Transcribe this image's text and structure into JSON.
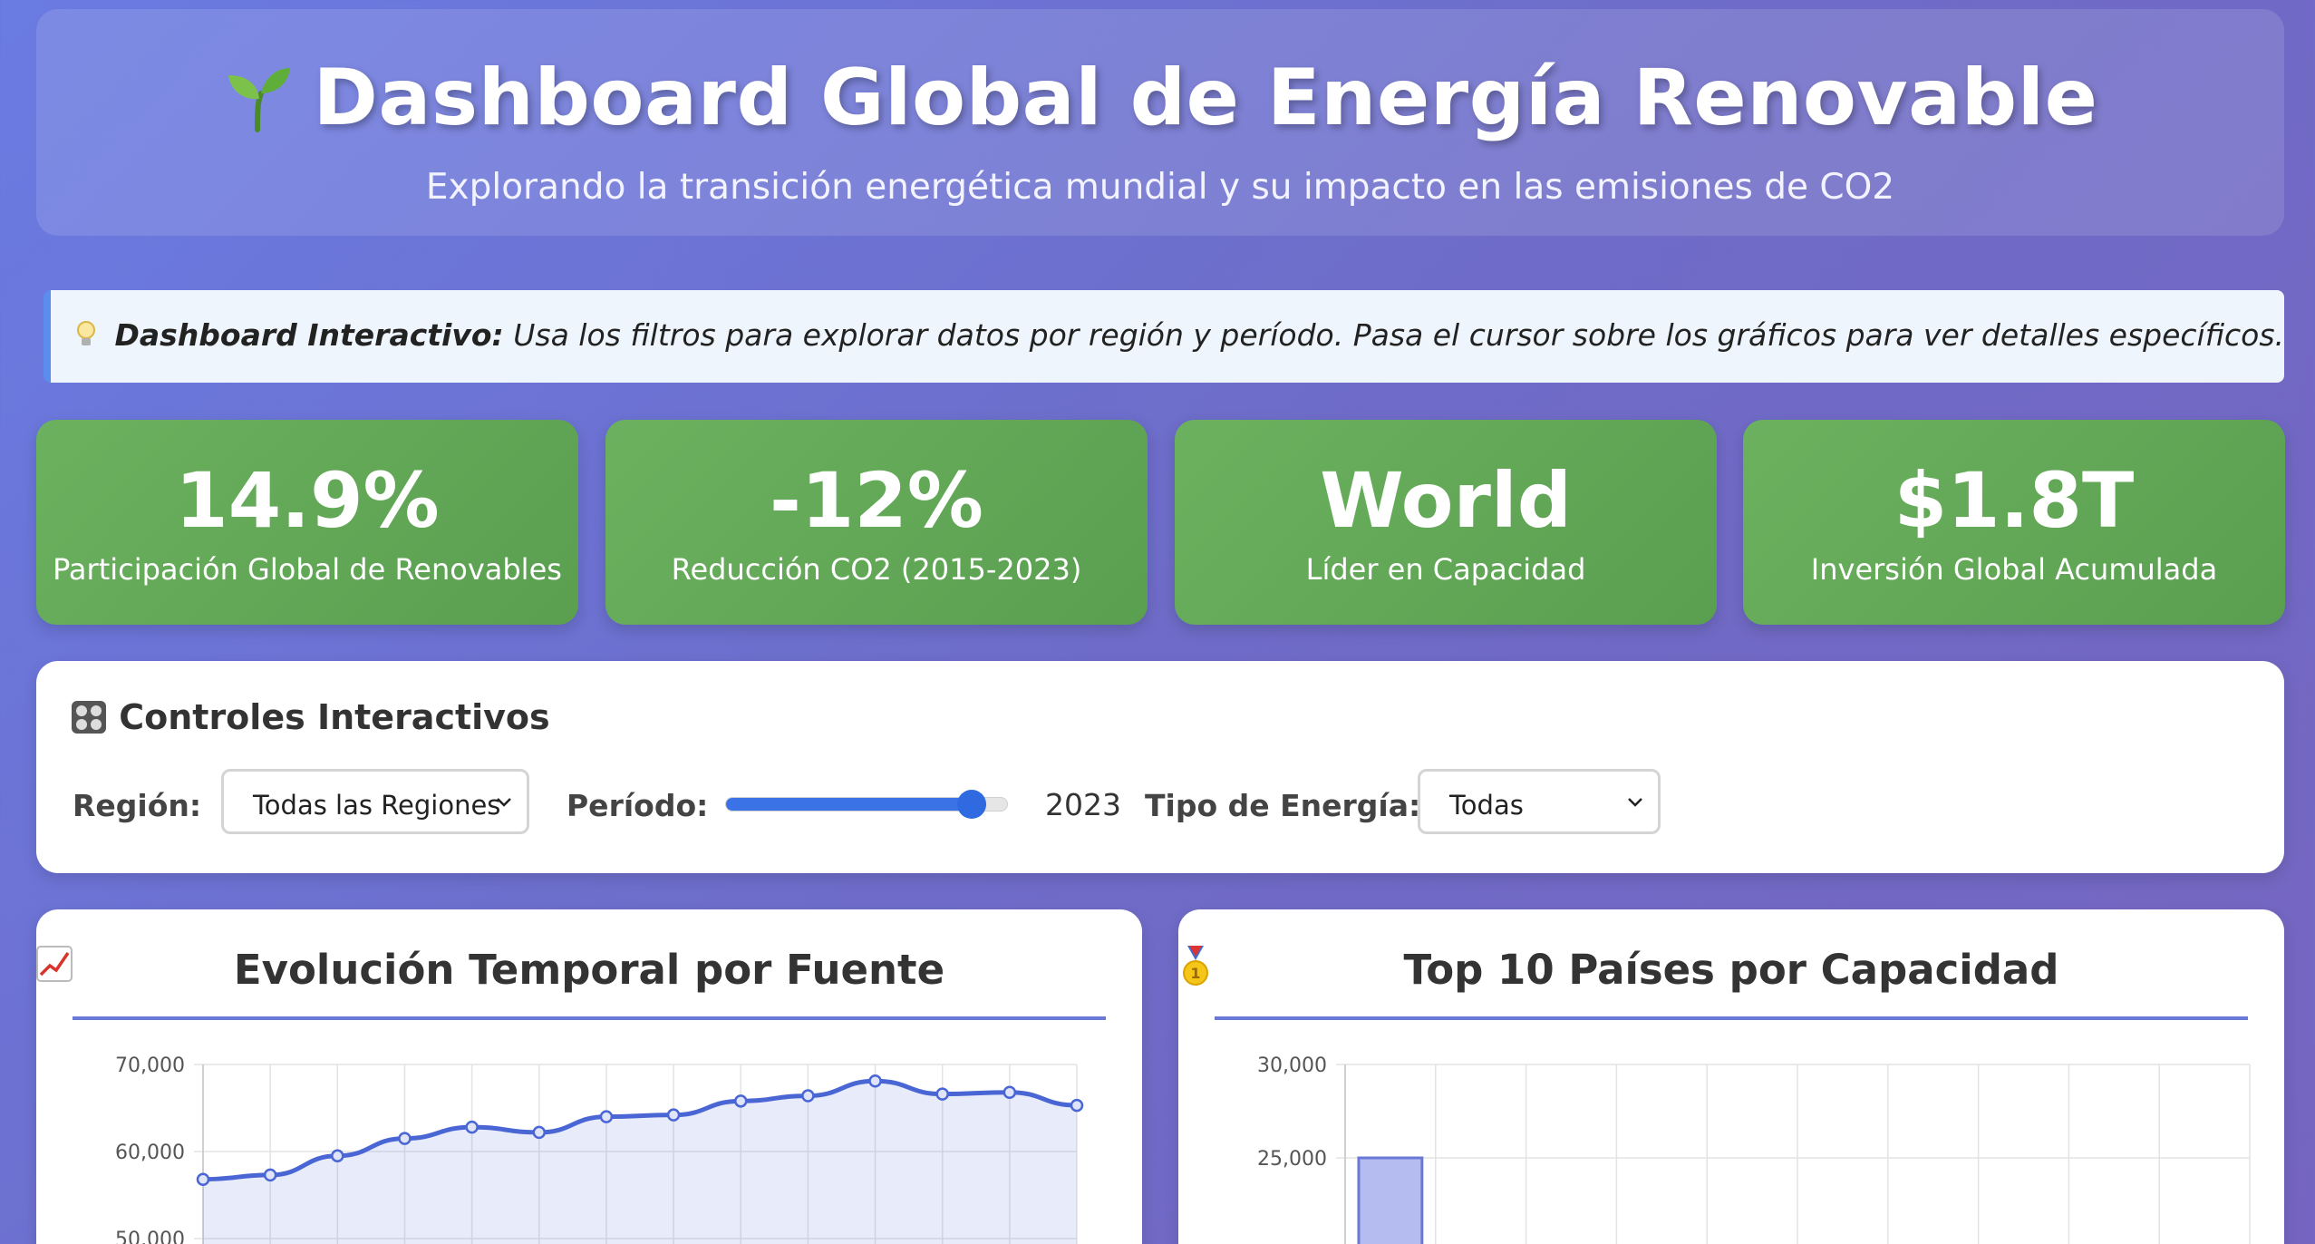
{
  "header": {
    "icon": "seedling-icon",
    "title": "Dashboard Global de Energía Renovable",
    "subtitle": "Explorando la transición energética mundial y su impacto en las emisiones de CO2"
  },
  "info": {
    "icon": "lightbulb-icon",
    "bold": "Dashboard Interactivo:",
    "text": "Usa los filtros para explorar datos por región y período. Pasa el cursor sobre los gráficos para ver detalles específicos."
  },
  "kpis": [
    {
      "value": "14.9%",
      "label": "Participación Global de Renovables"
    },
    {
      "value": "-12%",
      "label": "Reducción CO2 (2015-2023)"
    },
    {
      "value": "World",
      "label": "Líder en Capacidad"
    },
    {
      "value": "$1.8T",
      "label": "Inversión Global Acumulada"
    }
  ],
  "controls": {
    "icon": "control-knobs-icon",
    "title": "Controles Interactivos",
    "region_label": "Región:",
    "region_value": "Todas las Regiones",
    "period_label": "Período:",
    "period_value": "2023",
    "period_fraction": 0.87,
    "energy_label": "Tipo de Energía:",
    "energy_value": "Todas"
  },
  "colors": {
    "accent": "#3b73e6",
    "kpi_green": "#62a857",
    "line": "#4a66d4",
    "bar_fill": "#b4bcf0",
    "bar_stroke": "#6a78d8"
  },
  "chart_left": {
    "icon": "chart-increasing-icon",
    "title": "Evolución Temporal por Fuente"
  },
  "chart_right": {
    "icon": "gold-medal-icon",
    "title": "Top 10 Países por Capacidad"
  },
  "chart_data": [
    {
      "type": "area",
      "title": "Evolución Temporal por Fuente",
      "y_ticks": [
        "70,000",
        "60,000",
        "50,000"
      ],
      "ylim": [
        50000,
        70000
      ],
      "grid": true,
      "series": [
        {
          "values": [
            56800,
            57300,
            59500,
            61500,
            62800,
            62200,
            64000,
            64200,
            65800,
            66400,
            68100,
            66600,
            66800,
            65300
          ]
        }
      ]
    },
    {
      "type": "bar",
      "title": "Top 10 Países por Capacidad",
      "y_ticks": [
        "30,000",
        "25,000"
      ],
      "ylim": [
        20000,
        30000
      ],
      "grid": true,
      "values": [
        25000
      ]
    }
  ]
}
